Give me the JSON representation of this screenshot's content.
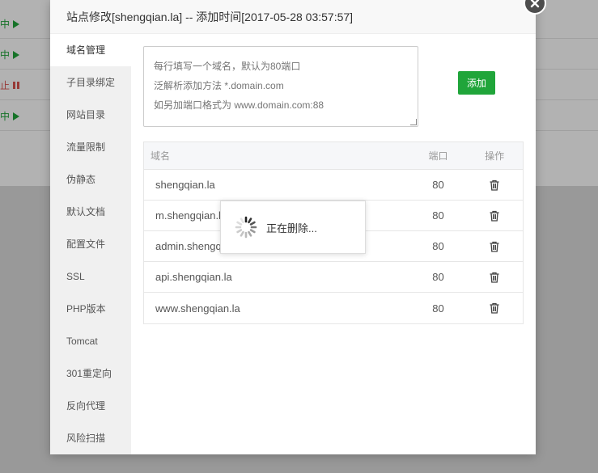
{
  "background": {
    "rows": [
      {
        "status": "中",
        "kind": "run"
      },
      {
        "status": "中",
        "kind": "run"
      },
      {
        "status": "止",
        "kind": "stop"
      },
      {
        "status": "中",
        "kind": "run"
      }
    ]
  },
  "modal": {
    "title": "站点修改[shengqian.la] -- 添加时间[2017-05-28 03:57:57]",
    "close_icon": "close-icon"
  },
  "sidebar": {
    "items": [
      {
        "label": "域名管理",
        "active": true
      },
      {
        "label": "子目录绑定"
      },
      {
        "label": "网站目录"
      },
      {
        "label": "流量限制"
      },
      {
        "label": "伪静态"
      },
      {
        "label": "默认文档"
      },
      {
        "label": "配置文件"
      },
      {
        "label": "SSL"
      },
      {
        "label": "PHP版本"
      },
      {
        "label": "Tomcat"
      },
      {
        "label": "301重定向"
      },
      {
        "label": "反向代理"
      },
      {
        "label": "风险扫描"
      }
    ]
  },
  "domain_form": {
    "placeholder": "每行填写一个域名，默认为80端口\n泛解析添加方法 *.domain.com\n如另加端口格式为 www.domain.com:88",
    "add_label": "添加"
  },
  "table": {
    "headers": {
      "name": "域名",
      "port": "端口",
      "op": "操作"
    },
    "rows": [
      {
        "name": "shengqian.la",
        "port": "80"
      },
      {
        "name": "m.shengqian.la",
        "port": "80"
      },
      {
        "name": "admin.shengqian.la",
        "port": "80"
      },
      {
        "name": "api.shengqian.la",
        "port": "80"
      },
      {
        "name": "www.shengqian.la",
        "port": "80"
      }
    ]
  },
  "loading": {
    "text": "正在删除..."
  },
  "colors": {
    "accent": "#20a53a",
    "stop": "#d9534f"
  }
}
